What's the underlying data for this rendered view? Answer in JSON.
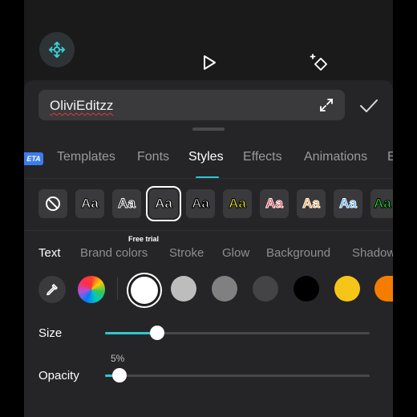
{
  "colors": {
    "accent": "#29c9d6",
    "beta_badge": "#3d7bf0",
    "spellcheck": "#e53935"
  },
  "toolbar": {
    "fab_icon": "crosshair-move-icon",
    "play_icon": "play-icon",
    "magic_icon": "magic-wand-icon"
  },
  "text_input": {
    "value": "OliviEditzz",
    "expand_icon": "expand-icon",
    "confirm_icon": "checkmark-icon"
  },
  "tabs": {
    "beta_label": "ETA",
    "items": [
      {
        "label": "Templates",
        "active": false
      },
      {
        "label": "Fonts",
        "active": false
      },
      {
        "label": "Styles",
        "active": true
      },
      {
        "label": "Effects",
        "active": false
      },
      {
        "label": "Animations",
        "active": false
      },
      {
        "label": "E",
        "active": false
      }
    ]
  },
  "presets": {
    "none_icon": "no-style-icon",
    "items": [
      {
        "label": "Aa",
        "style": "black-outline-white"
      },
      {
        "label": "Aa",
        "style": "white-outline-black"
      },
      {
        "label": "Aa",
        "style": "outlined-selected",
        "selected": true
      },
      {
        "label": "Aa",
        "style": "black-outline-white-bold"
      },
      {
        "label": "Aa",
        "style": "yellow"
      },
      {
        "label": "Aa",
        "style": "red"
      },
      {
        "label": "Aa",
        "style": "orange"
      },
      {
        "label": "Aa",
        "style": "blue"
      },
      {
        "label": "Aa",
        "style": "green"
      }
    ],
    "badge": "Free trial"
  },
  "subtabs": {
    "items": [
      {
        "label": "Text",
        "active": true
      },
      {
        "label": "Brand colors",
        "active": false
      },
      {
        "label": "Stroke",
        "active": false
      },
      {
        "label": "Glow",
        "active": false
      },
      {
        "label": "Background",
        "active": false
      },
      {
        "label": "Shadow",
        "active": false
      }
    ]
  },
  "swatches": {
    "picker_icon": "eyedropper-icon",
    "colors": [
      "#ffffff",
      "#bdbdbd",
      "#808080",
      "#444446",
      "#000000",
      "#f5c518",
      "#f57c00"
    ],
    "selected": "#ffffff"
  },
  "sliders": {
    "size": {
      "label": "Size",
      "value_fraction": 0.2
    },
    "opacity": {
      "label": "Opacity",
      "value_text": "5%",
      "value_fraction": 0.05
    }
  }
}
